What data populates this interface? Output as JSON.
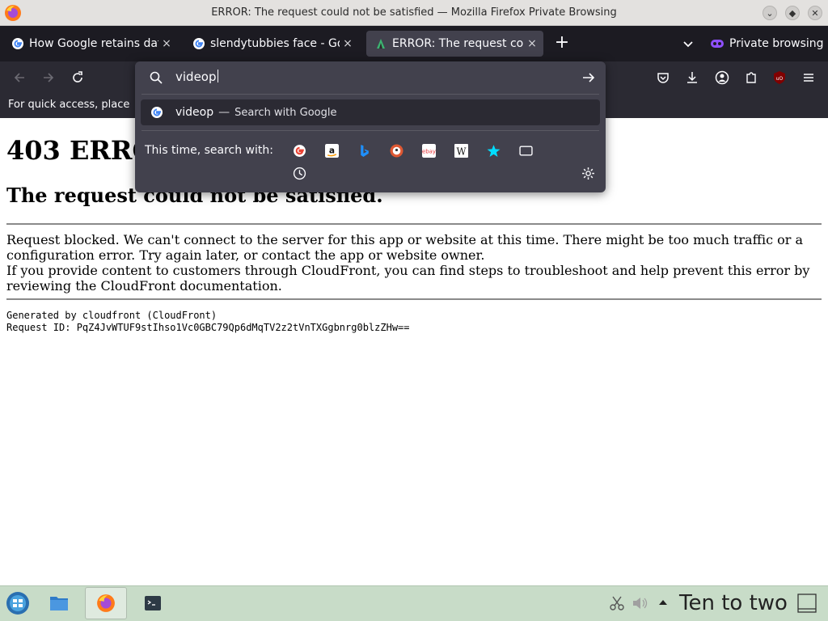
{
  "window": {
    "title": "ERROR: The request could not be satisfied — Mozilla Firefox Private Browsing"
  },
  "tabs": [
    {
      "title": "How Google retains data",
      "close": "×"
    },
    {
      "title": "slendytubbies face - Google",
      "close": "×"
    },
    {
      "title": "ERROR: The request could not be satisfied",
      "close": "×"
    }
  ],
  "tabstrip": {
    "new_tab": "+",
    "private_label": "Private browsing"
  },
  "bookmarks": {
    "hint": "For quick access, place"
  },
  "urlbar": {
    "value": "videop",
    "suggestion": {
      "query": "videop",
      "separator": "—",
      "action": "Search with Google"
    },
    "onesearch_label": "This time, search with:",
    "engines": [
      "google-icon",
      "amazon-icon",
      "bing-icon",
      "duckduckgo-icon",
      "ebay-icon",
      "wikipedia-icon",
      "bookmarks-star-icon",
      "tabs-icon",
      "history-icon"
    ]
  },
  "page": {
    "heading": "403 ERROR",
    "subheading": "The request could not be satisfied.",
    "paragraph1": "Request blocked. We can't connect to the server for this app or website at this time. There might be too much traffic or a configuration error. Try again later, or contact the app or website owner.",
    "paragraph2": "If you provide content to customers through CloudFront, you can find steps to troubleshoot and help prevent this error by reviewing the CloudFront documentation.",
    "generated_by": "Generated by cloudfront (CloudFront)",
    "request_id": "Request ID: PqZ4JvWTUF9stIhso1Vc0GBC79Qp6dMqTV2z2tVnTXGgbnrg0blzZHw=="
  },
  "taskbar": {
    "clock": "Ten to two"
  },
  "colors": {
    "tabstrip_bg": "#1c1b22",
    "toolbar_bg": "#2b2a33",
    "popup_bg": "#42414d",
    "taskbar_bg": "#c8dcc8",
    "private_accent": "#8f50ff"
  }
}
